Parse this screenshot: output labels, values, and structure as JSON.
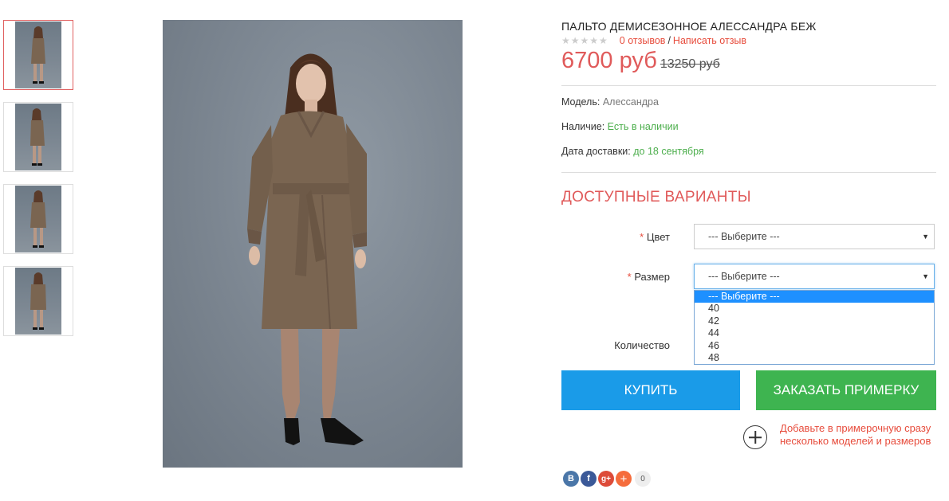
{
  "product": {
    "title": "ПАЛЬТО ДЕМИСЕЗОННОЕ АЛЕССАНДРА БЕЖ",
    "rating_stars": "★★★★★",
    "reviews_link": "0 отзывов",
    "rating_sep": "/",
    "write_review_link": "Написать отзыв",
    "price_new": "6700 руб",
    "price_old": "13250 руб"
  },
  "details": {
    "model_label": "Модель:",
    "model_value": "Алессандра",
    "stock_label": "Наличие:",
    "stock_value": "Есть в наличии",
    "delivery_label": "Дата доставки:",
    "delivery_value": "до 18 сентября"
  },
  "options": {
    "title": "ДОСТУПНЫЕ ВАРИАНТЫ",
    "required_mark": "*",
    "color_label": "Цвет",
    "color_value": "--- Выберите ---",
    "size_label": "Размер",
    "size_value": "--- Выберите ---",
    "size_options": [
      "--- Выберите ---",
      "40",
      "42",
      "44",
      "46",
      "48"
    ],
    "quantity_label": "Количество"
  },
  "buttons": {
    "buy": "КУПИТЬ",
    "try_on": "ЗАКАЗАТЬ ПРИМЕРКУ"
  },
  "try_on_note": "Добавьте в примерочную сразу несколько моделей и размеров",
  "social": {
    "vk": "В",
    "fb": "f",
    "gp": "g+",
    "add": "+",
    "count": "0"
  },
  "colors": {
    "accent_red": "#e05a5a",
    "link_red": "#e74c3c",
    "in_stock_green": "#4cae4c",
    "buy_blue": "#1a9be8",
    "tryon_green": "#3eb450",
    "coat_brown": "#7a6551"
  }
}
